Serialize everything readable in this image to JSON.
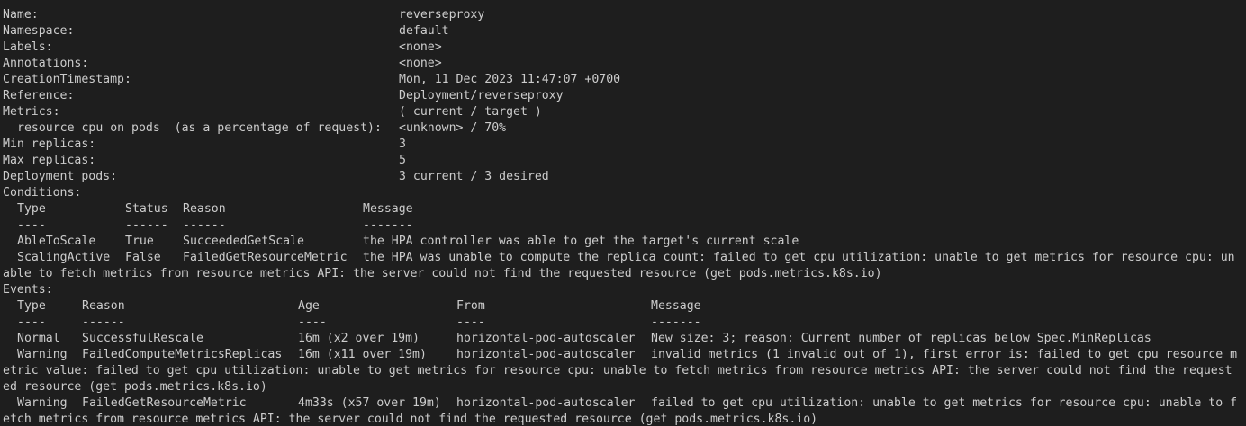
{
  "meta": {
    "name_key": "Name:",
    "name_val": "reverseproxy",
    "namespace_key": "Namespace:",
    "namespace_val": "default",
    "labels_key": "Labels:",
    "labels_val": "<none>",
    "annotations_key": "Annotations:",
    "annotations_val": "<none>",
    "created_key": "CreationTimestamp:",
    "created_val": "Mon, 11 Dec 2023 11:47:07 +0700",
    "reference_key": "Reference:",
    "reference_val": "Deployment/reverseproxy",
    "metrics_key": "Metrics:",
    "metrics_val": "( current / target )",
    "resource_key": "resource cpu on pods  (as a percentage of request):",
    "resource_val": "<unknown> / 70%",
    "min_key": "Min replicas:",
    "min_val": "3",
    "max_key": "Max replicas:",
    "max_val": "5",
    "pods_key": "Deployment pods:",
    "pods_val": "3 current / 3 desired"
  },
  "conditions": {
    "title": "Conditions:",
    "headers": [
      "Type",
      "Status",
      "Reason",
      "Message"
    ],
    "underlines": [
      "----",
      "------",
      "------",
      "-------"
    ],
    "rows": [
      {
        "type": "AbleToScale",
        "status": "True",
        "reason": "SucceededGetScale",
        "message": "the HPA controller was able to get the target's current scale"
      },
      {
        "type": "ScalingActive",
        "status": "False",
        "reason": "FailedGetResourceMetric",
        "message": "the HPA was unable to compute the replica count: failed to get cpu utilization: unable to get metrics for resource cpu: un",
        "message_cont": "able to fetch metrics from resource metrics API: the server could not find the requested resource (get pods.metrics.k8s.io)"
      }
    ]
  },
  "events": {
    "title": "Events:",
    "headers": [
      "Type",
      "Reason",
      "Age",
      "From",
      "Message"
    ],
    "underlines": [
      "----",
      "------",
      "----",
      "----",
      "-------"
    ],
    "rows": [
      {
        "type": "Normal",
        "reason": "SuccessfulRescale",
        "age": "16m (x2 over 19m)",
        "from": "horizontal-pod-autoscaler",
        "message": "New size: 3; reason: Current number of replicas below Spec.MinReplicas"
      },
      {
        "type": "Warning",
        "reason": "FailedComputeMetricsReplicas",
        "age": "16m (x11 over 19m)",
        "from": "horizontal-pod-autoscaler",
        "message": "invalid metrics (1 invalid out of 1), first error is: failed to get cpu resource m",
        "message_cont1": "etric value: failed to get cpu utilization: unable to get metrics for resource cpu: unable to fetch metrics from resource metrics API: the server could not find the request",
        "message_cont2": "ed resource (get pods.metrics.k8s.io)"
      },
      {
        "type": "Warning",
        "reason": "FailedGetResourceMetric",
        "age": "4m33s (x57 over 19m)",
        "from": "horizontal-pod-autoscaler",
        "message": "failed to get cpu utilization: unable to get metrics for resource cpu: unable to f",
        "message_cont1": "etch metrics from resource metrics API: the server could not find the requested resource (get pods.metrics.k8s.io)"
      }
    ]
  }
}
